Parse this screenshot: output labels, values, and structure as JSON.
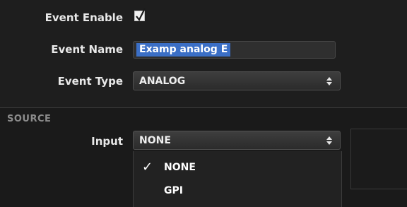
{
  "event": {
    "enable_label": "Event Enable",
    "enable_checked": true,
    "name_label": "Event Name",
    "name_value": "Examp analog E",
    "type_label": "Event Type",
    "type_value": "ANALOG"
  },
  "source": {
    "section_label": "SOURCE",
    "input_label": "Input",
    "input_value": "NONE",
    "options": [
      {
        "label": "NONE",
        "selected": true,
        "check": "✓"
      },
      {
        "label": "GPI",
        "selected": false,
        "check": ""
      }
    ]
  },
  "icons": {
    "checkbox_mark": "checkmark-icon",
    "select_arrows": "up-down-arrows-icon"
  },
  "colors": {
    "selection_highlight": "#3b6fc6"
  }
}
